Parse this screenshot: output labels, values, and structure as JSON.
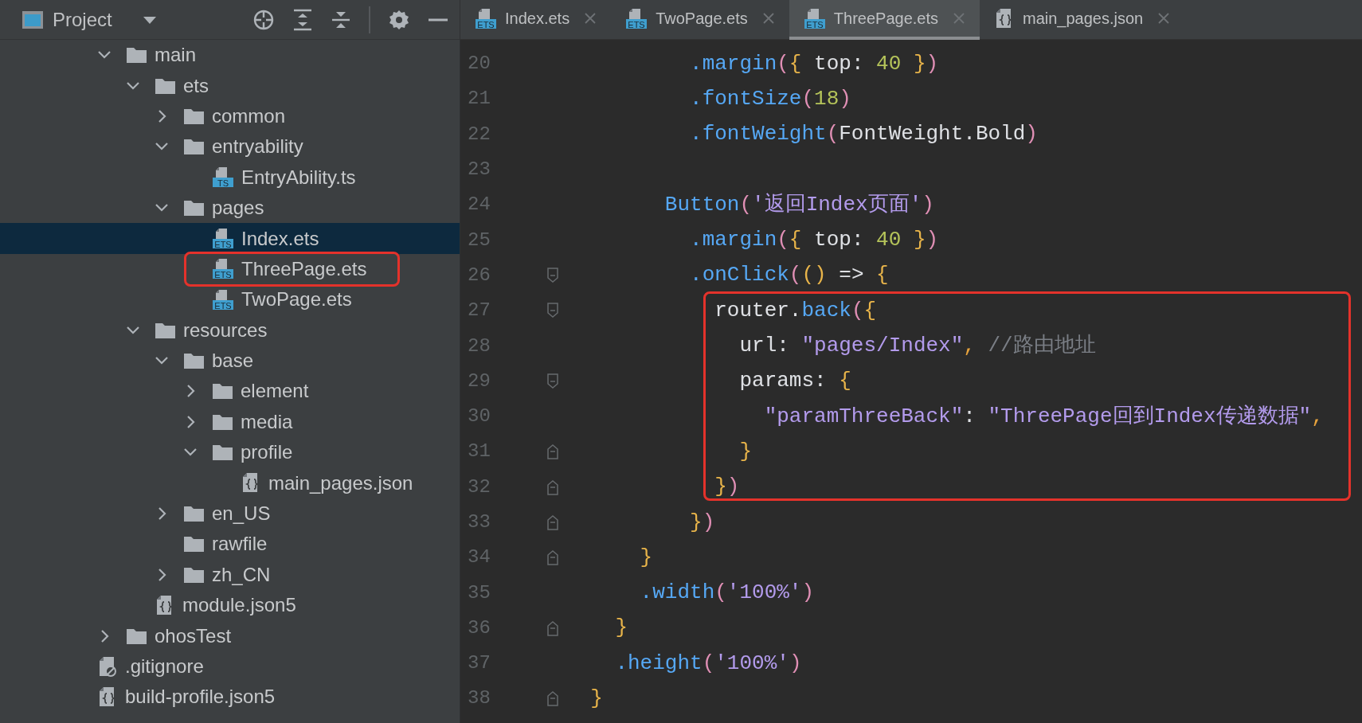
{
  "sidebar": {
    "title": "Project",
    "tree": [
      {
        "label": "main",
        "kind": "folder",
        "expanded": true,
        "selected": false,
        "children": [
          {
            "label": "ets",
            "kind": "folder",
            "expanded": true,
            "selected": false,
            "children": [
              {
                "label": "common",
                "kind": "folder",
                "expanded": false,
                "selected": false
              },
              {
                "label": "entryability",
                "kind": "folder",
                "expanded": true,
                "selected": false,
                "children": [
                  {
                    "label": "EntryAbility.ts",
                    "kind": "script",
                    "icon_text": "TS",
                    "selected": false
                  }
                ]
              },
              {
                "label": "pages",
                "kind": "folder",
                "expanded": true,
                "selected": false,
                "children": [
                  {
                    "label": "Index.ets",
                    "kind": "script",
                    "icon_text": "ETS",
                    "selected": true
                  },
                  {
                    "label": "ThreePage.ets",
                    "kind": "script",
                    "icon_text": "ETS",
                    "selected": false,
                    "circled": true
                  },
                  {
                    "label": "TwoPage.ets",
                    "kind": "script",
                    "icon_text": "ETS",
                    "selected": false
                  }
                ]
              }
            ]
          },
          {
            "label": "resources",
            "kind": "folder",
            "expanded": true,
            "selected": false,
            "children": [
              {
                "label": "base",
                "kind": "folder",
                "expanded": true,
                "selected": false,
                "children": [
                  {
                    "label": "element",
                    "kind": "folder",
                    "expanded": false,
                    "selected": false
                  },
                  {
                    "label": "media",
                    "kind": "folder",
                    "expanded": false,
                    "selected": false
                  },
                  {
                    "label": "profile",
                    "kind": "folder",
                    "expanded": true,
                    "selected": false,
                    "children": [
                      {
                        "label": "main_pages.json",
                        "kind": "json",
                        "selected": false
                      }
                    ]
                  }
                ]
              },
              {
                "label": "en_US",
                "kind": "folder",
                "expanded": false,
                "selected": false
              },
              {
                "label": "rawfile",
                "kind": "folder",
                "selected": false
              },
              {
                "label": "zh_CN",
                "kind": "folder",
                "expanded": false,
                "selected": false
              }
            ]
          },
          {
            "label": "module.json5",
            "kind": "json",
            "selected": false
          }
        ]
      },
      {
        "label": "ohosTest",
        "kind": "folder",
        "expanded": false,
        "selected": false
      }
    ],
    "outer_items": [
      {
        "label": ".gitignore",
        "kind": "ignore",
        "selected": false
      },
      {
        "label": "build-profile.json5",
        "kind": "json",
        "selected": false
      }
    ]
  },
  "tabs": [
    {
      "label": "Index.ets",
      "kind": "script",
      "icon_text": "ETS",
      "selected": false
    },
    {
      "label": "TwoPage.ets",
      "kind": "script",
      "icon_text": "ETS",
      "selected": false
    },
    {
      "label": "ThreePage.ets",
      "kind": "script",
      "icon_text": "ETS",
      "selected": true
    },
    {
      "label": "main_pages.json",
      "kind": "json",
      "selected": false
    }
  ],
  "code": {
    "lines": [
      {
        "number": "20",
        "tokens": [
          {
            "t": "          .margin",
            "kind": "method"
          },
          {
            "t": "(",
            "kind": "paren"
          },
          {
            "t": "{",
            "kind": "brace"
          },
          {
            "t": " top: ",
            "kind": "plain"
          },
          {
            "t": "40",
            "kind": "number"
          },
          {
            "t": " }",
            "kind": "brace"
          },
          {
            "t": ")",
            "kind": "paren"
          }
        ]
      },
      {
        "number": "21",
        "tokens": [
          {
            "t": "          .fontSize",
            "kind": "method"
          },
          {
            "t": "(",
            "kind": "paren"
          },
          {
            "t": "18",
            "kind": "number"
          },
          {
            "t": ")",
            "kind": "paren"
          }
        ]
      },
      {
        "number": "22",
        "tokens": [
          {
            "t": "          .fontWeight",
            "kind": "method"
          },
          {
            "t": "(",
            "kind": "paren"
          },
          {
            "t": "FontWeight.Bold",
            "kind": "plain"
          },
          {
            "t": ")",
            "kind": "paren"
          }
        ]
      },
      {
        "number": "23"
      },
      {
        "number": "24",
        "tokens": [
          {
            "t": "        Button",
            "kind": "method"
          },
          {
            "t": "(",
            "kind": "paren"
          },
          {
            "t": "'返回Index页面'",
            "kind": "string"
          },
          {
            "t": ")",
            "kind": "paren"
          }
        ]
      },
      {
        "number": "25",
        "tokens": [
          {
            "t": "          .margin",
            "kind": "method"
          },
          {
            "t": "(",
            "kind": "paren"
          },
          {
            "t": "{",
            "kind": "brace"
          },
          {
            "t": " top: ",
            "kind": "plain"
          },
          {
            "t": "40",
            "kind": "number"
          },
          {
            "t": " }",
            "kind": "brace"
          },
          {
            "t": ")",
            "kind": "paren"
          }
        ]
      },
      {
        "number": "26",
        "kind": "opener",
        "tokens": [
          {
            "t": "          .onClick",
            "kind": "method"
          },
          {
            "t": "(",
            "kind": "paren"
          },
          {
            "t": "()",
            "kind": "brace"
          },
          {
            "t": " => ",
            "kind": "plain"
          },
          {
            "t": "{",
            "kind": "brace"
          }
        ]
      },
      {
        "number": "27",
        "kind": "opener",
        "boxed": true,
        "tokens": [
          {
            "t": "            router.",
            "kind": "plain"
          },
          {
            "t": "back",
            "kind": "method"
          },
          {
            "t": "(",
            "kind": "paren"
          },
          {
            "t": "{",
            "kind": "brace"
          }
        ]
      },
      {
        "number": "28",
        "boxed": true,
        "tokens": [
          {
            "t": "              url: ",
            "kind": "plain"
          },
          {
            "t": "\"pages/Index\"",
            "kind": "string"
          },
          {
            "t": ",",
            "kind": "punct"
          },
          {
            "t": " //路由地址",
            "kind": "comment"
          }
        ]
      },
      {
        "number": "29",
        "kind": "opener",
        "boxed": true,
        "tokens": [
          {
            "t": "              params: ",
            "kind": "plain"
          },
          {
            "t": "{",
            "kind": "brace"
          }
        ]
      },
      {
        "number": "30",
        "boxed": true,
        "tokens": [
          {
            "t": "                \"paramThreeBack\"",
            "kind": "string"
          },
          {
            "t": ": ",
            "kind": "plain"
          },
          {
            "t": "\"ThreePage回到Index传递数据\"",
            "kind": "string"
          },
          {
            "t": ",",
            "kind": "punct"
          }
        ]
      },
      {
        "number": "31",
        "kind": "closer",
        "boxed": true,
        "tokens": [
          {
            "t": "              }",
            "kind": "brace"
          }
        ]
      },
      {
        "number": "32",
        "kind": "closer",
        "boxed": true,
        "tokens": [
          {
            "t": "            }",
            "kind": "brace"
          },
          {
            "t": ")",
            "kind": "paren"
          }
        ]
      },
      {
        "number": "33",
        "kind": "closer",
        "tokens": [
          {
            "t": "          }",
            "kind": "brace"
          },
          {
            "t": ")",
            "kind": "paren"
          }
        ]
      },
      {
        "number": "34",
        "kind": "closer",
        "tokens": [
          {
            "t": "      }",
            "kind": "brace"
          }
        ]
      },
      {
        "number": "35",
        "tokens": [
          {
            "t": "      .width",
            "kind": "method"
          },
          {
            "t": "(",
            "kind": "paren"
          },
          {
            "t": "'100%'",
            "kind": "string"
          },
          {
            "t": ")",
            "kind": "paren"
          }
        ]
      },
      {
        "number": "36",
        "kind": "closer",
        "tokens": [
          {
            "t": "    }",
            "kind": "brace"
          }
        ]
      },
      {
        "number": "37",
        "tokens": [
          {
            "t": "    .height",
            "kind": "method"
          },
          {
            "t": "(",
            "kind": "paren"
          },
          {
            "t": "'100%'",
            "kind": "string"
          },
          {
            "t": ")",
            "kind": "paren"
          }
        ]
      },
      {
        "number": "38",
        "kind": "closer",
        "tokens": [
          {
            "t": "  }",
            "kind": "brace"
          }
        ]
      }
    ]
  }
}
